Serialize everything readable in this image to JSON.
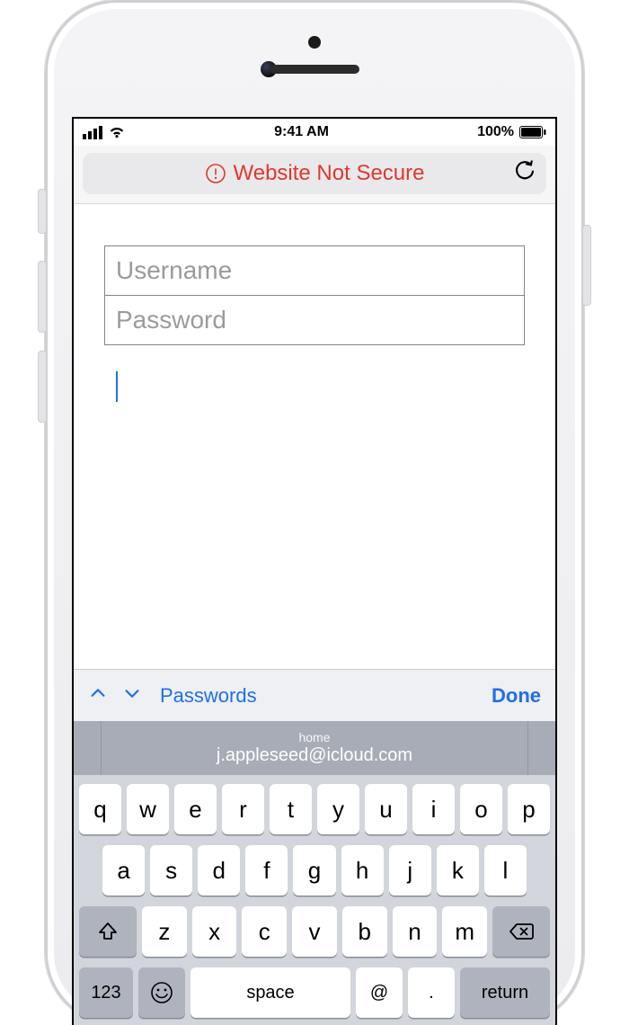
{
  "status": {
    "time": "9:41 AM",
    "battery": "100%"
  },
  "urlbar": {
    "warning_text": "Website Not Secure"
  },
  "form": {
    "username_placeholder": "Username",
    "password_placeholder": "Password"
  },
  "accessory": {
    "label": "Passwords",
    "done": "Done"
  },
  "autofill": {
    "category": "home",
    "value": "j.appleseed@icloud.com"
  },
  "keyboard": {
    "row1": [
      "q",
      "w",
      "e",
      "r",
      "t",
      "y",
      "u",
      "i",
      "o",
      "p"
    ],
    "row2": [
      "a",
      "s",
      "d",
      "f",
      "g",
      "h",
      "j",
      "k",
      "l"
    ],
    "row3": [
      "z",
      "x",
      "c",
      "v",
      "b",
      "n",
      "m"
    ],
    "numbers": "123",
    "space": "space",
    "at": "@",
    "dot": ".",
    "return": "return"
  }
}
